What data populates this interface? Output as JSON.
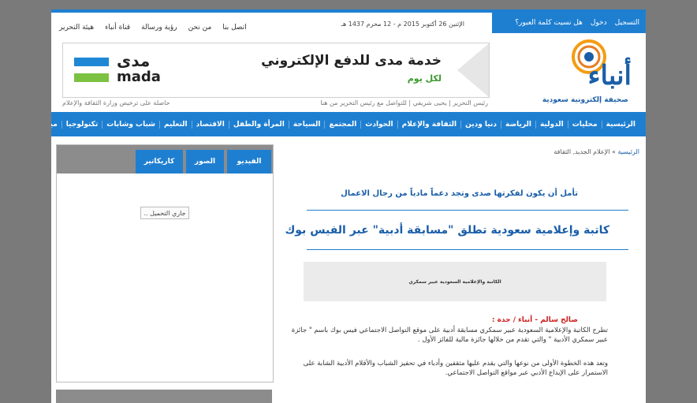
{
  "header": {
    "login": {
      "register": "التسجيل",
      "login": "دخول",
      "forgot": "هل نسيت كلمة العبور؟"
    },
    "date": "الإثنين 26 أكتوبر 2015 م - 12 محرم 1437 هـ",
    "top_links": [
      "هيئة التحرير",
      "قناة أنباء",
      "رؤية ورسالة",
      "من نحن",
      "اتصل بنا"
    ],
    "logo_text": "أنباء",
    "logo_subtitle": "صحيفة إلكترونية سعودية",
    "editor_line": "رئيس التحرير | يحيى شريفي | للتواصل مع رئيس التحرير من هنا",
    "license_line": "حاصلة على ترخيص وزارة الثقافة والإعلام"
  },
  "banner": {
    "title": "خدمة مدى للدفع الإلكتروني",
    "subtitle": "لكل يوم",
    "brand_ar": "مدى",
    "brand_en": "mada",
    "colors": {
      "blue": "#1e88d4",
      "green": "#7cc242"
    }
  },
  "nav": {
    "items": [
      "الرئيسية",
      "محليات",
      "الدولية",
      "الرياضة",
      "دنيا ودين",
      "الثقافة والإعلام",
      "الحوادث",
      "المجتمع",
      "السياحة",
      "المرأة والطفل",
      "الاقتصاد",
      "التعليم",
      "شباب وشابات",
      "تكنولوجيا",
      "ميديا"
    ]
  },
  "sidebar": {
    "tabs": [
      "الفيديو",
      "الصور",
      "كاريكاتير"
    ],
    "loading_text": "جاري التحميل .."
  },
  "article": {
    "breadcrumb_home": "الرئيسية",
    "breadcrumb_sep": "»",
    "breadcrumb_path": "الإعلام الجديد, الثقافة",
    "subtitle": "تأمل أن يكون لفكرتها صدى وتجد دعماً مادياً من رجال الاعمال",
    "title": "كاتبة وإعلامية سعودية تطلق \"مسابقة أدبية\" عبر الفيس بوك",
    "image_caption": "الكاتبة والإعلامية السعودية عبير سمكري",
    "byline": "صالح سالم - أنباء / جدة :",
    "paragraph1": "تطرح الكاتبة والإعلامية السعودية عبير سمكري مسابقة أدبية على موقع التواصل الاجتماعي فيس بوك باسم \" جائزة عبير سمكري الأدبية \" والتي تقدم من خلالها جائزة مالية للفائز الأول .",
    "paragraph2": "وتعد هذه الخطوة الأولى من نوعها والتي يقدم عليها مثقفين وأدباء في تحفيز الشباب والأقلام الأدبية الشابة على الاستمرار على الإبداع الأدبي عبر مواقع التواصل الاجتماعي."
  },
  "colors": {
    "accent": "#1e7fd1",
    "title": "#1a5ea8",
    "byline": "#cc2020"
  }
}
